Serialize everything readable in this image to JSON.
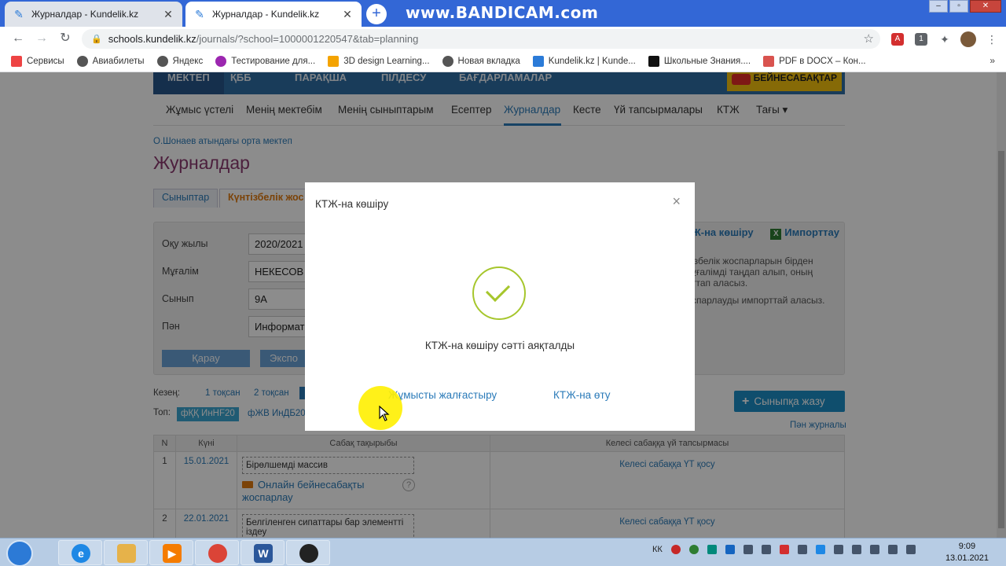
{
  "browser": {
    "tabs": [
      {
        "title": "Журналдар - Kundelik.kz",
        "active": false
      },
      {
        "title": "Журналдар - Kundelik.kz",
        "active": true
      }
    ],
    "watermark": "www.BANDICAM.com",
    "url_host": "schools.kundelik.kz",
    "url_path": "/journals/?school=1000001220547&tab=planning",
    "bookmarks": [
      {
        "label": "Сервисы",
        "icon": "apps-grid-icon",
        "color": "#e44"
      },
      {
        "label": "Авиабилеты",
        "icon": "globe-icon",
        "color": "#555"
      },
      {
        "label": "Яндекс",
        "icon": "globe-icon",
        "color": "#555"
      },
      {
        "label": "Тестирование для...",
        "icon": "test-icon",
        "color": "#9c27b0"
      },
      {
        "label": "3D design Learning...",
        "icon": "grid-icon",
        "color": "#f4a300"
      },
      {
        "label": "Новая вкладка",
        "icon": "globe-icon",
        "color": "#555"
      },
      {
        "label": "Kundelik.kz | Kunde...",
        "icon": "kundelik-icon",
        "color": "#2b7bd8"
      },
      {
        "label": "Школьные Знания....",
        "icon": "znanija-icon",
        "color": "#111"
      },
      {
        "label": "PDF в DOCX – Кон...",
        "icon": "pdf-icon",
        "color": "#d9534f"
      }
    ],
    "bookmarks_more": "»"
  },
  "page": {
    "topnav": [
      "МЕКТЕП",
      "ҚББ",
      "ПАРАҚША",
      "ПІЛДЕСУ",
      "БАҒДАРЛАМАЛАР"
    ],
    "yt_banner": "БЕЙНЕСАБАҚТАР",
    "subnav": [
      "Жұмыс үстелі",
      "Менің мектебім",
      "Менің сыныптарым",
      "Есептер",
      "Журналдар",
      "Кесте",
      "Үй тапсырмалары",
      "КТЖ",
      "Тағы ▾"
    ],
    "school": "О.Шонаев атындағы орта мектеп",
    "title": "Журналдар",
    "tabs": [
      "Сыныптар",
      "Күнтізбелік жос"
    ],
    "filters": {
      "year_label": "Оқу жылы",
      "year_value": "2020/2021",
      "teacher_label": "Мұғалім",
      "teacher_value": "НЕКЕСОВ",
      "class_label": "Сынып",
      "class_value": "9А",
      "subject_label": "Пән",
      "subject_value": "Информат"
    },
    "btn_view": "Қарау",
    "btn_export": "Экспо",
    "right_links": {
      "ktzh": "Ж-на көшіру",
      "import": "Импорттау"
    },
    "right_text": [
      "ізбелік жоспарларын бірден",
      "ұғалімді таңдап алып, оның",
      "ттап аласыз.",
      "спарлауды импорттай аласыз."
    ],
    "period_label": "Кезең:",
    "periods": [
      "1 тоқсан",
      "2 тоқсан"
    ],
    "group_label": "Топ:",
    "group_tag": "фҚҚ ИнНF20",
    "group_link": "фЖВ ИнДБ20",
    "write_btn": "Сыныпқа жазу",
    "subject_journal": "Пән журналы",
    "table": {
      "headers": [
        "N",
        "Күні",
        "Сабақ тақырыбы",
        "Келесі сабаққа үй тапсырмасы"
      ],
      "rows": [
        {
          "n": "1",
          "date": "15.01.2021",
          "topic": "Бірөлшемді массив",
          "video": "Онлайн бейнесабақты жоспарлау",
          "hw": "Келесі сабаққа ҮТ қосу"
        },
        {
          "n": "2",
          "date": "22.01.2021",
          "topic": "Белгіленген сипаттары бар элементті іздеу",
          "hw": "Келесі сабаққа ҮТ қосу"
        }
      ]
    }
  },
  "modal": {
    "title": "КТЖ-на көшіру",
    "close": "×",
    "message": "КТЖ-на көшіру сәтті аяқталды",
    "continue": "Жұмысты жалғастыру",
    "goto": "КТЖ-на өту",
    "accent": "#a6c62c"
  },
  "taskbar": {
    "lang": "КК",
    "time": "9:09",
    "date": "13.01.2021"
  }
}
